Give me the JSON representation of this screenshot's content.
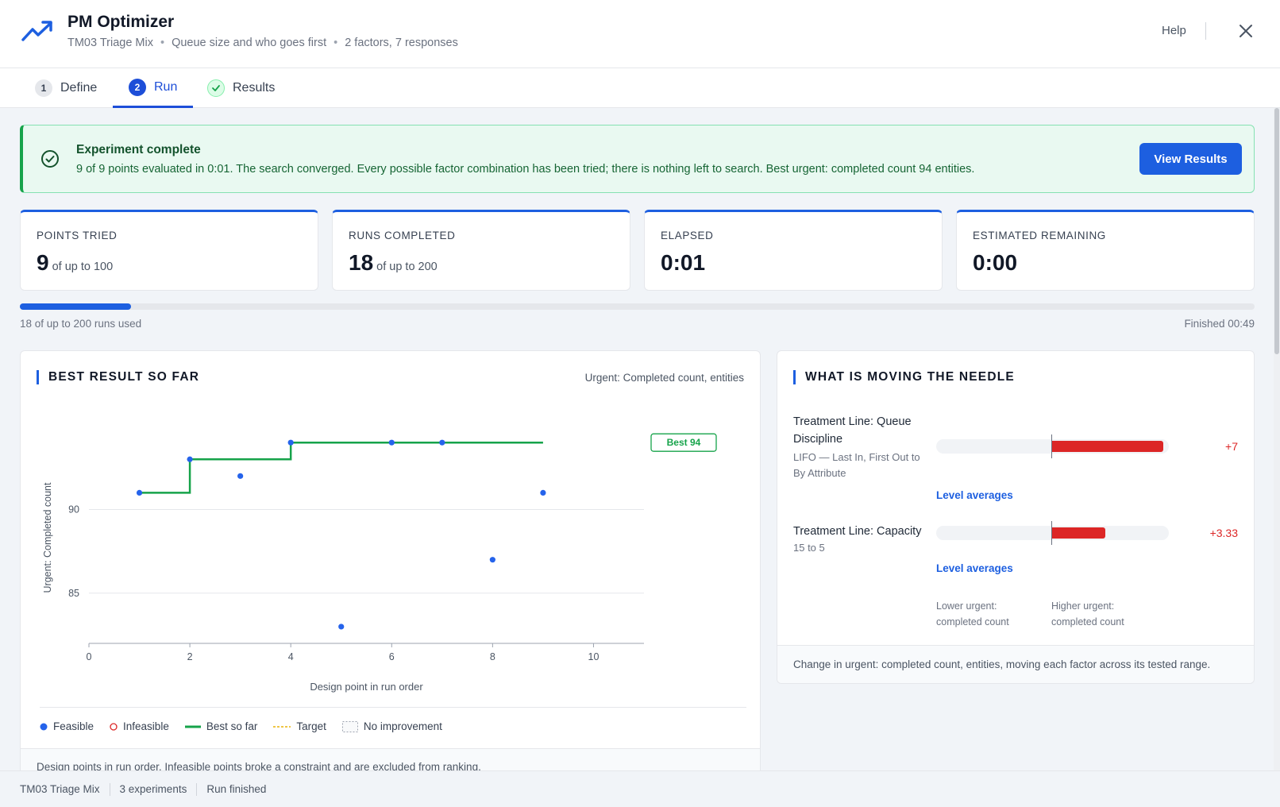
{
  "app": {
    "title": "PM Optimizer",
    "model": "TM03 Triage Mix",
    "description": "Queue size and who goes first",
    "summary": "2 factors, 7 responses",
    "help_label": "Help"
  },
  "tabs": [
    {
      "num": "1",
      "label": "Define",
      "state": "default"
    },
    {
      "num": "2",
      "label": "Run",
      "state": "active"
    },
    {
      "num": "",
      "label": "Results",
      "state": "done"
    }
  ],
  "banner": {
    "title": "Experiment complete",
    "text": "9 of 9 points evaluated in 0:01. The search converged. Every possible factor combination has been tried; there is nothing left to search. Best urgent: completed count 94 entities.",
    "button_label": "View Results"
  },
  "stats": [
    {
      "label": "POINTS TRIED",
      "value": "9",
      "sub": "of up to 100"
    },
    {
      "label": "RUNS COMPLETED",
      "value": "18",
      "sub": "of up to 200"
    },
    {
      "label": "ELAPSED",
      "value": "0:01",
      "sub": ""
    },
    {
      "label": "ESTIMATED REMAINING",
      "value": "0:00",
      "sub": ""
    }
  ],
  "progress": {
    "fraction": 0.09,
    "left_text": "18 of up to 200 runs used",
    "right_text": "Finished 00:49"
  },
  "best_panel": {
    "title": "BEST RESULT SO FAR",
    "metric": "Urgent: Completed count, entities",
    "footnote": "Design points in run order. Infeasible points broke a constraint and are excluded from ranking.",
    "legend": {
      "feasible": "Feasible",
      "infeasible": "Infeasible",
      "best": "Best so far",
      "target": "Target",
      "no_improvement": "No improvement"
    }
  },
  "chart_data": {
    "type": "scatter",
    "xlabel": "Design point in run order",
    "ylabel": "Urgent: Completed count",
    "xlim": [
      0,
      11
    ],
    "ylim": [
      82,
      97
    ],
    "xticks": [
      0,
      2,
      4,
      6,
      8,
      10
    ],
    "yticks": [
      85,
      90
    ],
    "grid": true,
    "series": [
      {
        "name": "Feasible",
        "x": [
          1,
          2,
          3,
          4,
          5,
          6,
          7,
          8,
          9
        ],
        "y": [
          91,
          93,
          92,
          94,
          83,
          94,
          94,
          87,
          91
        ]
      },
      {
        "name": "Best so far",
        "x": [
          1,
          2,
          2,
          4,
          4,
          9
        ],
        "y": [
          91,
          91,
          93,
          93,
          94,
          94
        ]
      }
    ],
    "best_label": "Best 94",
    "colors": {
      "feasible": "#2563eb",
      "best": "#16a34a",
      "infeasible": "#dc2626",
      "target": "#eab308"
    }
  },
  "needle_panel": {
    "title": "WHAT IS MOVING THE NEEDLE",
    "factors": [
      {
        "name": "Treatment Line: Queue Discipline",
        "desc": "LIFO — Last In, First Out to By Attribute",
        "effect": 7,
        "value_label": "+7",
        "link": "Level averages"
      },
      {
        "name": "Treatment Line: Capacity",
        "desc": "15 to 5",
        "effect": 3.33,
        "value_label": "+3.33",
        "link": "Level averages"
      }
    ],
    "effect_max": 7,
    "axis_low": "Lower urgent: completed count",
    "axis_high": "Higher urgent: completed count",
    "footnote": "Change in urgent: completed count, entities, moving each factor across its tested range."
  },
  "statusbar": {
    "model": "TM03 Triage Mix",
    "experiments": "3 experiments",
    "state": "Run finished"
  }
}
